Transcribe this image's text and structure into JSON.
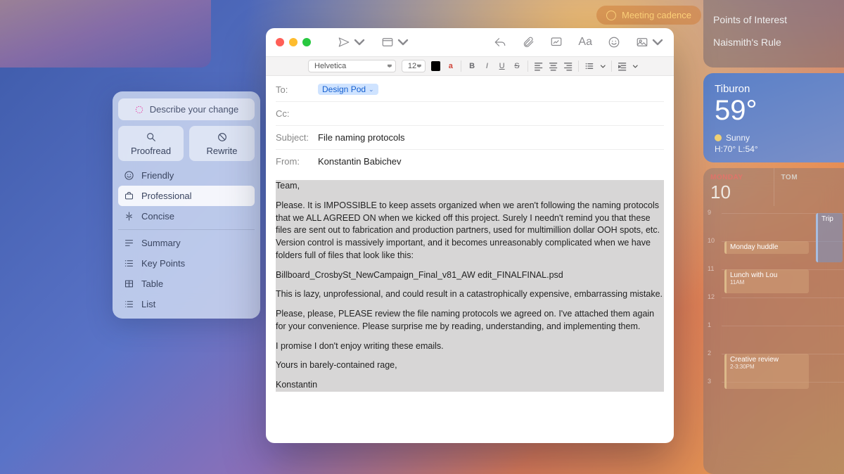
{
  "meetingPill": "Meeting cadence",
  "notes": {
    "row1": "Points of Interest",
    "row2": "Naismith's Rule"
  },
  "weather": {
    "city": "Tiburon",
    "temp": "59°",
    "cond": "Sunny",
    "hilo": "H:70° L:54°"
  },
  "cal": {
    "day1": {
      "dow": "MONDAY",
      "num": "10"
    },
    "day2": {
      "dow": "TOM",
      "num": ""
    },
    "hours": [
      "9",
      "10",
      "11",
      "12",
      "1",
      "2",
      "3"
    ],
    "ev1": "Monday huddle",
    "ev2": "Lunch with Lou",
    "ev2sub": "11AM",
    "ev3": "Creative review",
    "ev3sub": "2-3:30PM",
    "ev4": "Trip"
  },
  "wt": {
    "describe": "Describe your change",
    "proofread": "Proofread",
    "rewrite": "Rewrite",
    "friendly": "Friendly",
    "professional": "Professional",
    "concise": "Concise",
    "summary": "Summary",
    "keypoints": "Key Points",
    "table": "Table",
    "list": "List"
  },
  "fmt": {
    "font": "Helvetica",
    "size": "12"
  },
  "mail": {
    "toLabel": "To:",
    "toVal": "Design Pod",
    "ccLabel": "Cc:",
    "subjLabel": "Subject:",
    "subjVal": "File naming protocols",
    "fromLabel": "From:",
    "fromVal": "Konstantin Babichev",
    "p1": "Team,",
    "p2": "Please. It is IMPOSSIBLE to keep assets organized when we aren't following the naming protocols that we ALL AGREED ON when we kicked off this project. Surely I needn't remind you that these files are sent out to fabrication and production partners, used for multimillion dollar OOH spots, etc. Version control is massively important, and it becomes unreasonably complicated when we have folders full of files that look like this:",
    "p3": "Billboard_CrosbySt_NewCampaign_Final_v81_AW edit_FINALFINAL.psd",
    "p4": "This is lazy, unprofessional, and could result in a catastrophically expensive, embarrassing mistake.",
    "p5": "Please, please, PLEASE review the file naming protocols we agreed on. I've attached them again for your convenience. Please surprise me by reading, understanding, and implementing them.",
    "p6": "I promise I don't enjoy writing these emails.",
    "p7": "Yours in barely-contained rage,",
    "p8": "Konstantin"
  }
}
